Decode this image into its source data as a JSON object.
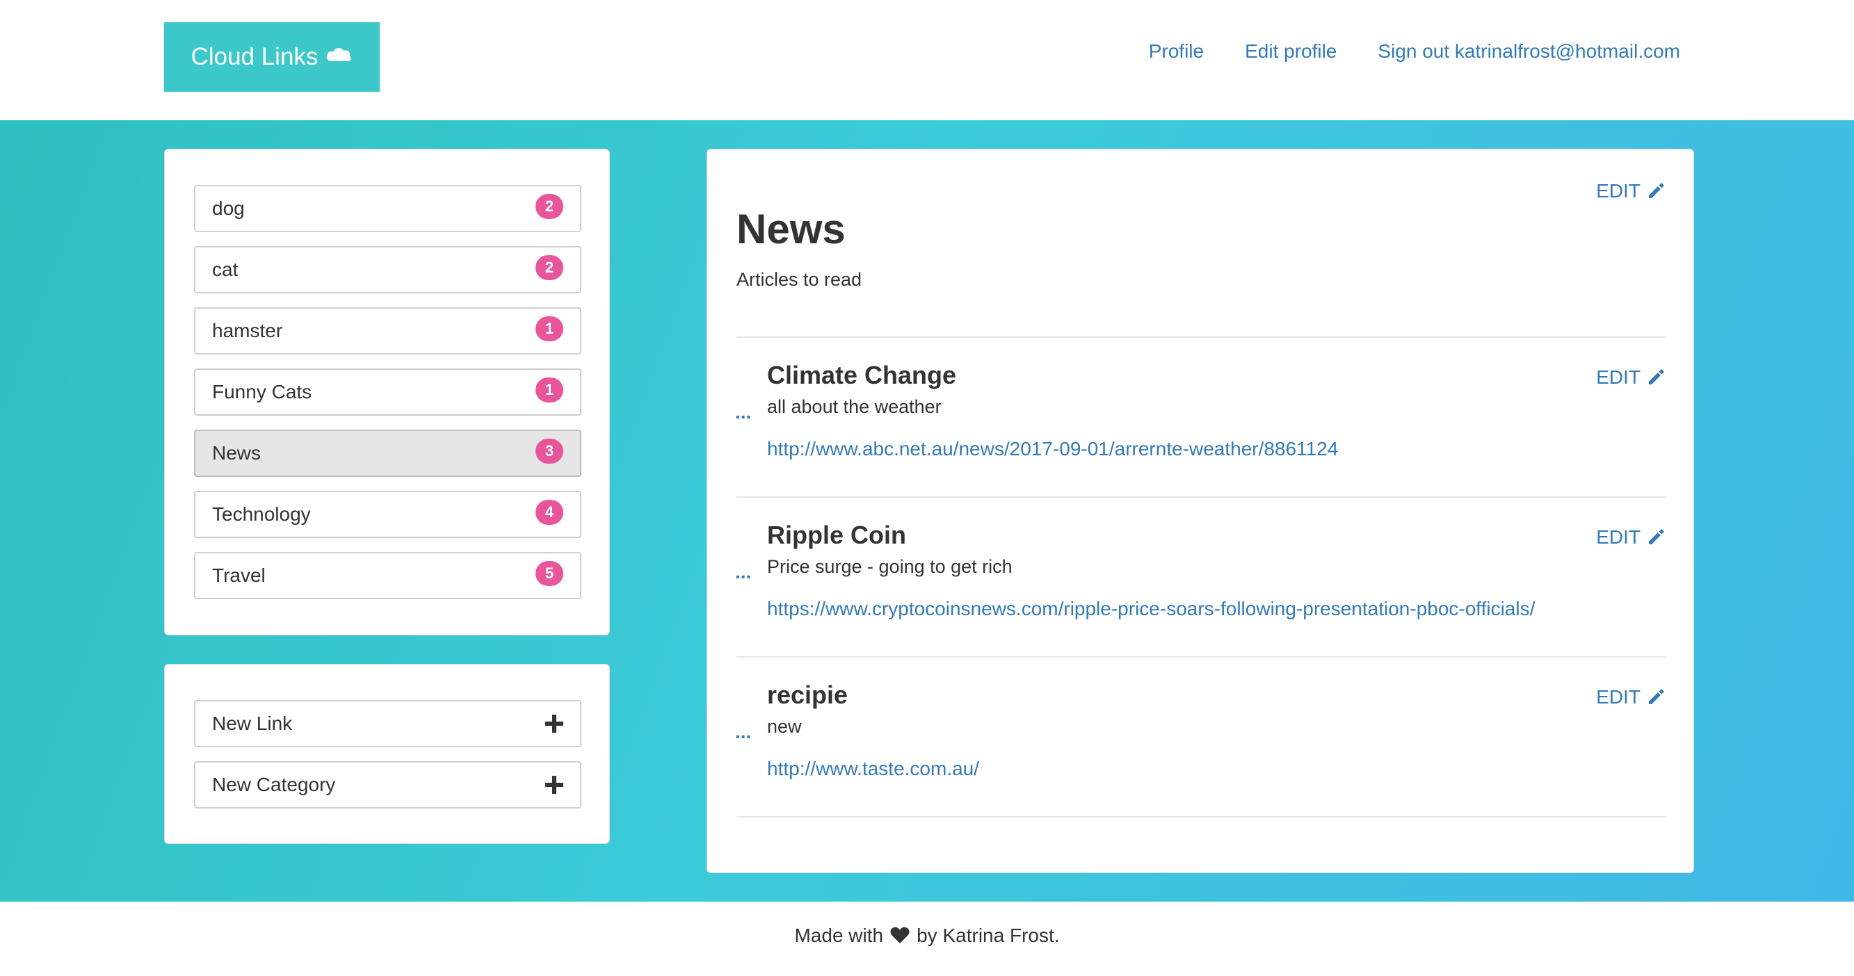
{
  "header": {
    "brand": "Cloud Links",
    "brand_icon": "cloud-icon",
    "nav": {
      "profile": "Profile",
      "edit_profile": "Edit profile",
      "sign_out": "Sign out katrinalfrost@hotmail.com"
    }
  },
  "sidebar": {
    "categories": [
      {
        "label": "dog",
        "count": "2"
      },
      {
        "label": "cat",
        "count": "2"
      },
      {
        "label": "hamster",
        "count": "1"
      },
      {
        "label": "Funny Cats",
        "count": "1"
      },
      {
        "label": "News",
        "count": "3",
        "active": true
      },
      {
        "label": "Technology",
        "count": "4"
      },
      {
        "label": "Travel",
        "count": "5"
      }
    ],
    "actions": {
      "new_link": "New Link",
      "new_category": "New Category",
      "icon": "plus-icon"
    }
  },
  "main": {
    "edit_label": "EDIT",
    "edit_icon": "pencil-icon",
    "category_title": "News",
    "category_description": "Articles to read",
    "links": [
      {
        "title": "Climate Change",
        "description": "all about the weather",
        "url": "http://www.abc.net.au/news/2017-09-01/arrernte-weather/8861124",
        "expander": "..."
      },
      {
        "title": "Ripple Coin",
        "description": "Price surge - going to get rich",
        "url": "https://www.cryptocoinsnews.com/ripple-price-soars-following-presentation-pboc-officials/",
        "expander": "..."
      },
      {
        "title": "recipie",
        "description": "new",
        "url": "http://www.taste.com.au/",
        "expander": "..."
      }
    ]
  },
  "footer": {
    "prefix": "Made with",
    "icon": "heart-icon",
    "suffix": "by Katrina Frost."
  },
  "colors": {
    "accent": "#337ab7",
    "brand": "#3cc8c8",
    "badge": "#e8559b",
    "gradient_start": "#30bfbf",
    "gradient_end": "#40b8e6"
  }
}
